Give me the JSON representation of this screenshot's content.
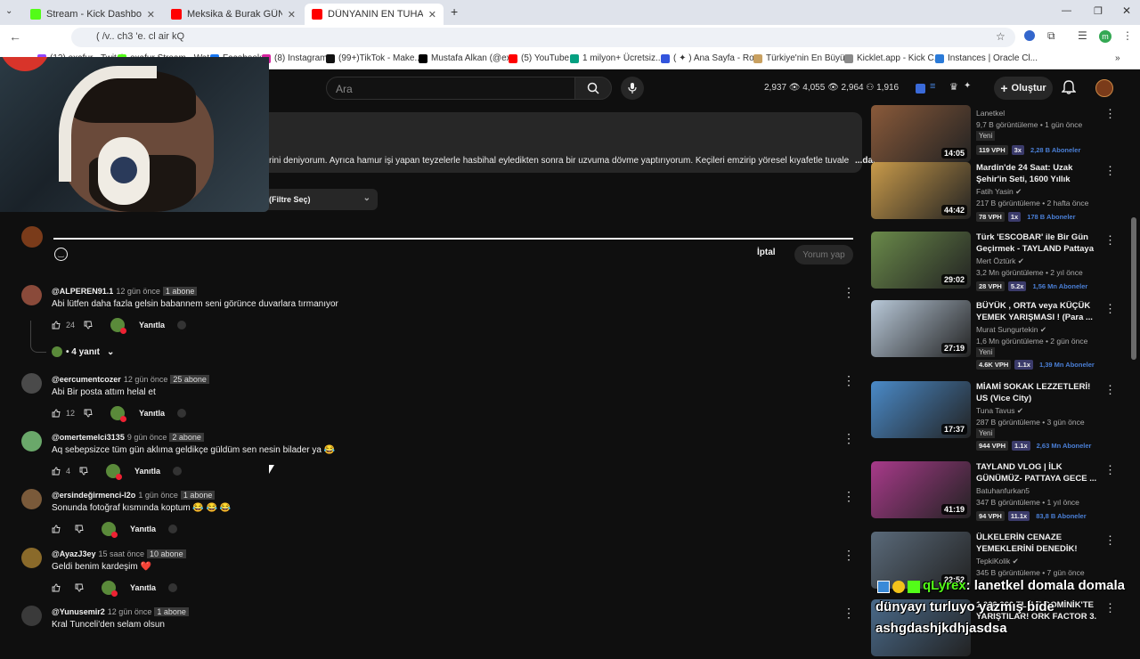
{
  "browser": {
    "tabs": [
      {
        "label": "Stream - Kick Dashboard",
        "color": "#53fc18"
      },
      {
        "label": "Meksika & Burak GÜNCÜ # Aşı",
        "color": "#ff0000"
      },
      {
        "label": "DÜNYANIN EN TUHAF YEMEKL",
        "color": "#ff0000"
      }
    ],
    "new_tab": "+",
    "url": "( /v.. ch3 'e. cl air kQ",
    "bookmarks": [
      {
        "label": "(12) exafur - Twitch"
      },
      {
        "label": "exafur Stream - Wat"
      },
      {
        "label": "Facebook"
      },
      {
        "label": "(8) Instagram"
      },
      {
        "label": "(99+)TikTok - Make..."
      },
      {
        "label": "Mustafa Alkan (@ex..."
      },
      {
        "label": "(5) YouTube"
      },
      {
        "label": "1 milyon+ Ücretsiz..."
      },
      {
        "label": "( ✦ ) Ana Sayfa - Ro..."
      },
      {
        "label": "Türkiye'nin En Büyü..."
      },
      {
        "label": "Kicklet.app - Kick C..."
      },
      {
        "label": "Instances | Oracle Cl..."
      }
    ],
    "profile_initial": "m"
  },
  "masthead": {
    "search_placeholder": "Ara",
    "stats": "2,937  👁 4,055  👁 2,964  ⚇ 1,916",
    "create_label": "Oluştur"
  },
  "description": {
    "text": "rini deniyorum. Ayrıca hamur işi yapan teyzelerle hasbihal eyledikten sonra bir uzvuma dövme yaptırıyorum. Keçileri emzirip yöresel kıyafetle tuvale",
    "more": "...daha fazla"
  },
  "filter_label": "(Filtre Seç)",
  "comment_box": {
    "cancel": "İptal",
    "submit": "Yorum yap"
  },
  "comments": [
    {
      "handle": "@ALPEREN91.1",
      "time": "12 gün önce",
      "subs": "1 abone",
      "text": "Abi lütfen daha fazla gelsin babannem seni görünce duvarlara tırmanıyor",
      "likes": "24",
      "reply": "Yanıtla",
      "avatar": "#8a4a3a"
    },
    {
      "handle": "@eercumentcozer",
      "time": "12 gün önce",
      "subs": "25 abone",
      "text": "Abi Bir posta attım helal et",
      "likes": "12",
      "reply": "Yanıtla",
      "avatar": "#4a4a4a"
    },
    {
      "handle": "@omertemelci3135",
      "time": "9 gün önce",
      "subs": "2 abone",
      "text": "Aq sebepsizce tüm gün aklıma geldikçe güldüm sen nesin bilader ya 😂",
      "likes": "4",
      "reply": "Yanıtla",
      "avatar": "#6aa86a"
    },
    {
      "handle": "@ersindeğirmenci-l2o",
      "time": "1 gün önce",
      "subs": "1 abone",
      "text": "Sonunda fotoğraf kısmında koptum 😂 😂 😂",
      "likes": "",
      "reply": "Yanıtla",
      "avatar": "#7a5a3a"
    },
    {
      "handle": "@AyazJ3ey",
      "time": "15 saat önce",
      "subs": "10 abone",
      "text": "Geldi benim kardeşim ❤️",
      "likes": "",
      "reply": "Yanıtla",
      "avatar": "#8a6a2a"
    },
    {
      "handle": "@Yunusemir2",
      "time": "12 gün önce",
      "subs": "1 abone",
      "text": "Kral Tunceli'den selam olsun",
      "likes": "",
      "reply": "",
      "avatar": "#3a3a3a"
    }
  ],
  "replies_label": "• 4 yanıt",
  "sidebar": [
    {
      "title": "",
      "channel": "Lanetkel",
      "meta": "9,7 B görüntüleme • 1 gün önce",
      "badge": "Yeni",
      "duration": "14:05",
      "vph": "119 VPH",
      "mult": "3x",
      "subs": "2,28 B Aboneler",
      "thumb": "#8a5a3a"
    },
    {
      "title": "Mardin'de 24 Saat: Uzak Şehir'in Seti, 1600 Yıllık Manastır ve ...",
      "channel": "Fatih Yasin ✔",
      "meta": "217 B görüntüleme • 2 hafta önce",
      "badge": "",
      "duration": "44:42",
      "vph": "78 VPH",
      "mult": "1x",
      "subs": "178 B Aboneler",
      "thumb": "#c89a4a"
    },
    {
      "title": "Türk 'ESCOBAR' ile Bir Gün Geçirmek - TAYLAND Pattaya TH",
      "channel": "Mert Öztürk ✔",
      "meta": "3,2 Mn görüntüleme • 2 yıl önce",
      "badge": "",
      "duration": "29:02",
      "vph": "28 VPH",
      "mult": "5.2x",
      "subs": "1,56 Mn Aboneler",
      "thumb": "#6a8a4a"
    },
    {
      "title": "BÜYÜK , ORTA veya KÜÇÜK YEMEK YARIŞMASI ! (Para ...",
      "channel": "Murat Sungurtekin ✔",
      "meta": "1,6 Mn görüntüleme • 2 gün önce",
      "badge": "Yeni",
      "duration": "27:19",
      "vph": "4.6K VPH",
      "mult": "1.1x",
      "subs": "1,39 Mn Aboneler",
      "thumb": "#b8c8d8"
    },
    {
      "title": "MİAMİ SOKAK LEZZETLERİ! US (Vice City)",
      "channel": "Tuna Tavus ✔",
      "meta": "287 B görüntüleme • 3 gün önce",
      "badge": "Yeni",
      "duration": "17:37",
      "vph": "944 VPH",
      "mult": "1.1x",
      "subs": "2,63 Mn Aboneler",
      "thumb": "#4a8ac8"
    },
    {
      "title": "TAYLAND VLOG | İLK GÜNÜMÜZ- PATTAYA GECE ...",
      "channel": "Batuhanfurkan5",
      "meta": "347 B görüntüleme • 1 yıl önce",
      "badge": "",
      "duration": "41:19",
      "vph": "94 VPH",
      "mult": "11.1x",
      "subs": "83,8 B Aboneler",
      "thumb": "#a83a8a"
    },
    {
      "title": "ÜLKELERİN CENAZE YEMEKLERİNİ DENEDİK!",
      "channel": "TepkiKolik ✔",
      "meta": "345 B görüntüleme • 7 gün önce",
      "badge": "",
      "duration": "22:52",
      "vph": "",
      "mult": "",
      "subs": "",
      "thumb": "#5a6a7a"
    },
    {
      "title": "1.000.000 TL İLE DOMİNİK'TE YARIŞTILAR! ORK FACTOR 3. ...",
      "channel": "...tmak ✔",
      "meta": "",
      "badge": "",
      "duration": "",
      "vph": "",
      "mult": "",
      "subs": "",
      "thumb": "#4a6a8a"
    }
  ],
  "chat_overlay": {
    "user": "qLyrex",
    "message": ": lanetkel domala domala",
    "line2": "dünyayı turluyo yazmış bide",
    "line3": "ashgdashjkdhjasdsa"
  }
}
